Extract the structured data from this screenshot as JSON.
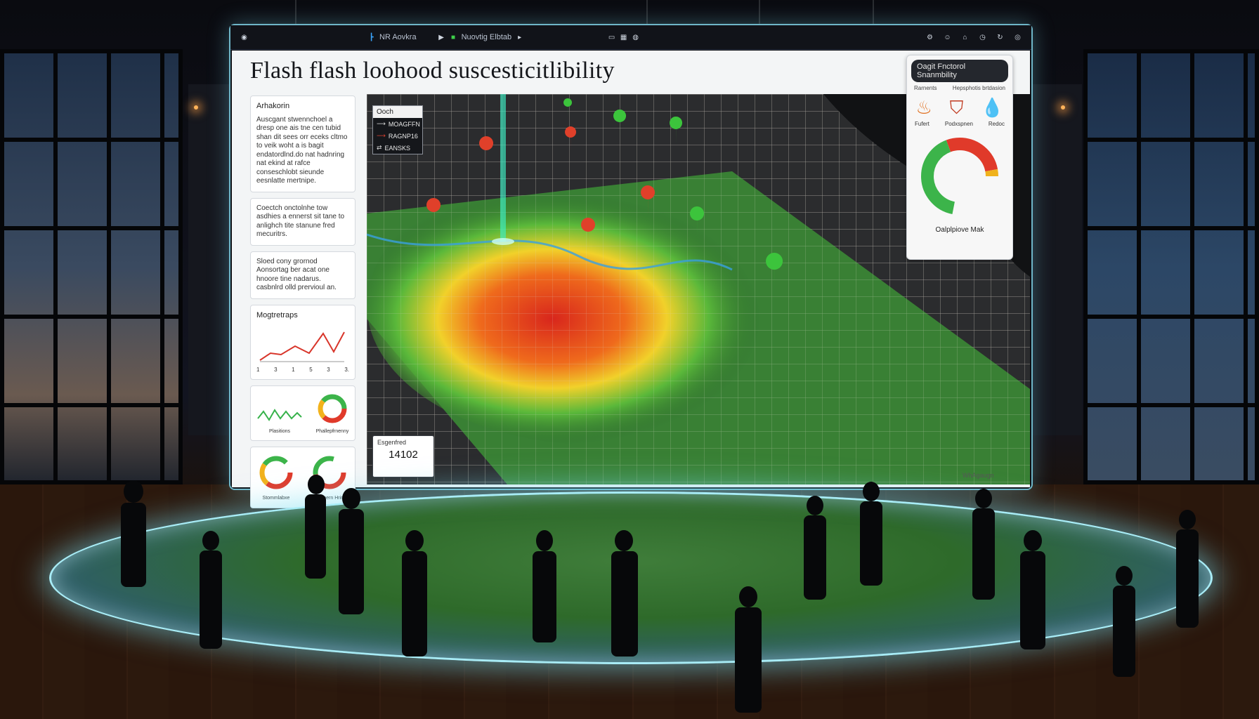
{
  "topbar": {
    "app_label": "NR Aovkra",
    "status_label": "Nuovtig Elbtab",
    "icons": [
      "monitor-icon",
      "settings-icon",
      "home-icon",
      "history-icon",
      "user-icon",
      "refresh-icon"
    ]
  },
  "title": "Flash  flash loohood  suscesticitlibility",
  "left_panel": {
    "intro_heading": "Arhakorin",
    "intro_text": "Auscgant stwennchoel a dresp one ais tne cen tubid shan dit sees orr eceks cltmo to veik woht a is bagit endatordlnd.do nat hadnring nat ekind at rafce conseschlobt sieunde eesnlatte mertnipe.",
    "paragraph2": "Coectch onctolnhe tow asdhies a ennerst sit tane to anlighch tite stanune fred mecuritrs.",
    "paragraph3": "Sloed cony grornod Aonsortag ber acat one hnoore tine nadarus. casbnlrd olld prervioul an.",
    "chart1_title": "Mogtretraps",
    "chart1_ticks": [
      "1",
      "3",
      "1",
      "5",
      "3",
      "3."
    ],
    "chart2_label": "Plasitions",
    "chart3_label": "Phallepfrnenny",
    "donut1_label": "Stommlabxe",
    "donut2_label": "Coumern Hrins"
  },
  "map": {
    "legend_title": "Ooch",
    "legend_rows": [
      "MOAGFFN",
      "RAGNP16",
      "EANSKS"
    ]
  },
  "right_panel": {
    "header": "Oagit Fnctorol Snanmbility",
    "col1": "Rarnents",
    "col2": "Hepsphotis brtdasion",
    "icon_labels": [
      "Fufert",
      "Podxspnen",
      "Redoc"
    ],
    "footer": "Oalplpiove Mak"
  },
  "stats": {
    "label": "Esgenfred",
    "value": "14102"
  },
  "watermark": "WhAgaugn"
}
